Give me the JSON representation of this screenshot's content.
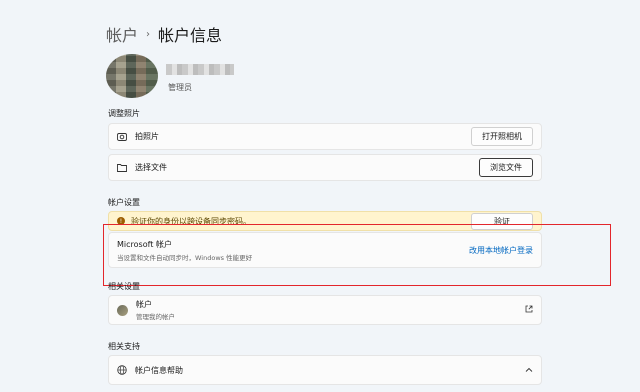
{
  "breadcrumb": {
    "parent": "帐户",
    "separator": "›",
    "current": "帐户信息"
  },
  "profile": {
    "role": "管理员"
  },
  "photo_section": {
    "title": "调整照片",
    "camera_label": "拍照片",
    "camera_button": "打开照相机",
    "file_label": "选择文件",
    "file_button": "浏览文件"
  },
  "account_section": {
    "title": "帐户设置",
    "warning_text": "验证你的身份以跨设备同步密码。",
    "verify_button": "验证",
    "ms_title": "Microsoft 帐户",
    "ms_subtitle": "当设置和文件自动同步时，Windows 性能更好",
    "local_link": "改用本地帐户登录"
  },
  "related_settings": {
    "title": "相关设置",
    "item_title": "帐户",
    "item_subtitle": "管理我的帐户"
  },
  "related_support": {
    "title": "相关支持",
    "item_title": "帐户信息帮助"
  },
  "colors": {
    "accent": "#0067c0",
    "highlight": "#e3262c",
    "warning_bg": "#fff4ce"
  }
}
